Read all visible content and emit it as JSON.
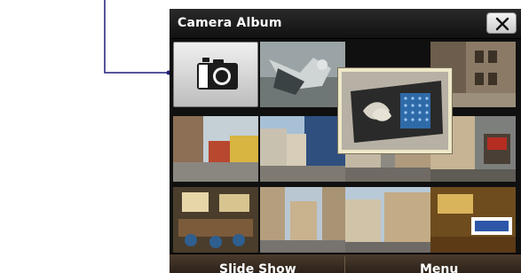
{
  "app": {
    "title": "Camera Album"
  },
  "title_bar": {
    "close_icon": "close-icon"
  },
  "grid": {
    "first_cell_icon": "camera-icon",
    "thumbnails": [
      {
        "name": "thumb-1-2"
      },
      {
        "name": "thumb-1-3-selected"
      },
      {
        "name": "thumb-1-4"
      },
      {
        "name": "thumb-2-1"
      },
      {
        "name": "thumb-2-2"
      },
      {
        "name": "thumb-2-3"
      },
      {
        "name": "thumb-2-4"
      },
      {
        "name": "thumb-3-1"
      },
      {
        "name": "thumb-3-2"
      },
      {
        "name": "thumb-3-3"
      },
      {
        "name": "thumb-3-4"
      }
    ]
  },
  "softkeys": {
    "left": "Slide Show",
    "right": "Menu"
  },
  "colors": {
    "callout_line": "#1f1f7a",
    "background": "#101010",
    "selection_border": "#eee8c8"
  }
}
